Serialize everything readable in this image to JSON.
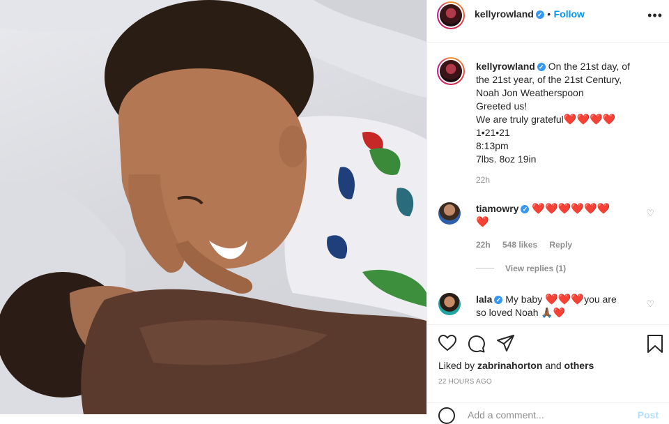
{
  "photo": {
    "alt_icon": "photo-of-boy-and-newborn"
  },
  "header": {
    "username": "kellyrowland",
    "separator": "•",
    "follow_label": "Follow",
    "more_icon": "more-options-icon"
  },
  "caption": {
    "username": "kellyrowland",
    "lines": [
      "On the 21st day, of",
      "the 21st year, of the 21st Century,",
      "Noah Jon Weatherspoon",
      "Greeted us!",
      "We are truly grateful",
      "1•21•21",
      "8:13pm",
      "7lbs. 8oz 19in"
    ],
    "hearts": "❤️❤️❤️❤️",
    "time": "22h"
  },
  "comments": [
    {
      "username": "tiamowry",
      "text": "❤️❤️❤️❤️❤️❤️",
      "text2": "❤️",
      "time": "22h",
      "likes": "548 likes",
      "reply": "Reply",
      "view_replies": "View replies (1)"
    },
    {
      "username": "lala",
      "text_a": "My baby ",
      "hearts": "❤️❤️❤️",
      "text_b": "you are",
      "text2": "so loved Noah 🙏🏾❤️"
    }
  ],
  "actions": {
    "liked_prefix": "Liked by ",
    "liked_user": "zabrinahorton",
    "liked_and": " and ",
    "liked_others": "others",
    "timestamp": "22 HOURS AGO",
    "add_comment_placeholder": "Add a comment...",
    "post_label": "Post"
  },
  "colors": {
    "accent": "#0095f6",
    "heart": "#ed4956",
    "muted": "#8e8e8e"
  }
}
